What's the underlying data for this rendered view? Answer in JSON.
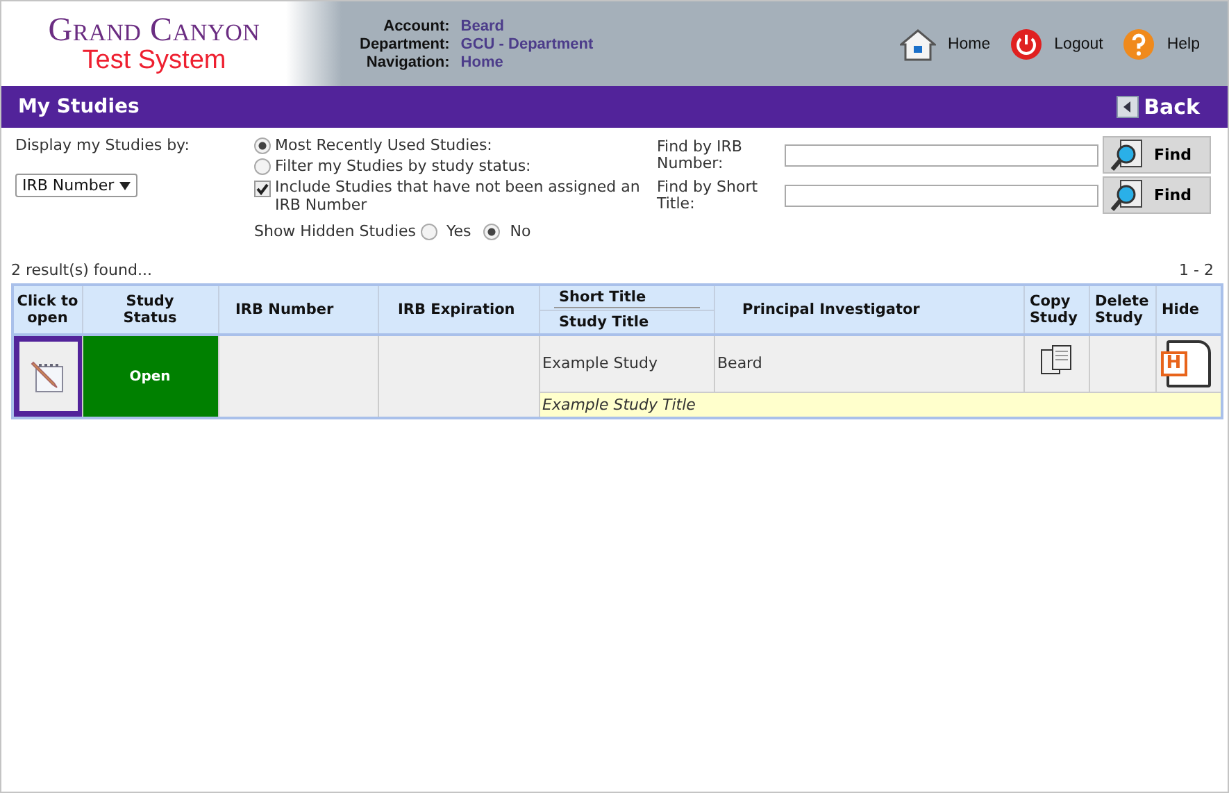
{
  "header": {
    "logo_title": "Grand Canyon",
    "logo_subtitle": "Test System",
    "info": [
      {
        "label": "Account:",
        "value": "Beard"
      },
      {
        "label": "Department:",
        "value": "GCU - Department"
      },
      {
        "label": "Navigation:",
        "value": "Home"
      }
    ],
    "links": [
      {
        "kind": "home",
        "label": "Home"
      },
      {
        "kind": "logout",
        "label": "Logout"
      },
      {
        "kind": "help",
        "label": "Help"
      }
    ]
  },
  "title_bar": {
    "title": "My Studies",
    "back_button": "Back"
  },
  "filters": {
    "display_label": "Display my Studies by:",
    "display_select": "IRB Number",
    "modes": [
      {
        "label": "Most Recently Used Studies:",
        "selected": true
      },
      {
        "label": "Filter my Studies by study status:",
        "selected": false
      }
    ],
    "include_unassigned": {
      "label": "Include Studies that have not been assigned an IRB Number",
      "checked": true
    },
    "show_hidden": {
      "label": "Show Hidden Studies",
      "options": [
        {
          "label": "Yes",
          "selected": false
        },
        {
          "label": "No",
          "selected": true
        }
      ]
    },
    "search": [
      {
        "label": "Find by IRB Number:",
        "button": "Find"
      },
      {
        "label": "Find by Short Title:",
        "button": "Find"
      }
    ]
  },
  "results_text": "2 result(s) found...",
  "pagination": "1 - 2",
  "table": {
    "columns": [
      "Click to open",
      "Study Status",
      "IRB Number",
      "IRB Expiration",
      "Short Title",
      "Principal Investigator",
      "Copy Study",
      "Delete Study",
      "Hide"
    ],
    "sub_column": "Study Title",
    "rows": [
      {
        "selected": true,
        "status": "Open",
        "color": "#008000",
        "short_title": "Example Study",
        "study_title": "Example Study Title",
        "principal_investigator": "Beard",
        "hide_icon_letter": "H"
      }
    ]
  }
}
